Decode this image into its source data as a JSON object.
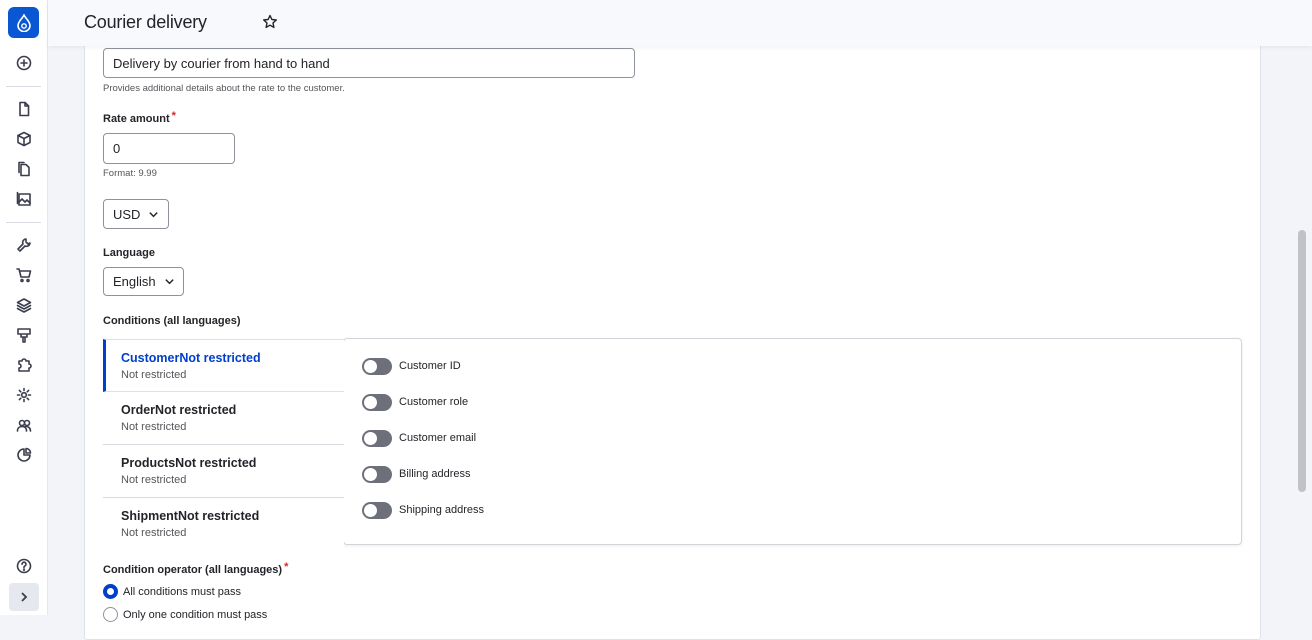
{
  "header": {
    "title": "Courier delivery"
  },
  "sidebar": {
    "icons": [
      "drupal-logo-icon",
      "add-circle-icon",
      "file-icon",
      "cube-icon",
      "files-icon",
      "image-icon",
      "wrench-icon",
      "cart-icon",
      "layers-icon",
      "paint-icon",
      "puzzle-icon",
      "gear-icon",
      "people-icon",
      "pie-chart-icon",
      "help-icon",
      "expand-chevron-icon"
    ]
  },
  "form": {
    "description_value": "Delivery by courier from hand to hand",
    "description_help": "Provides additional details about the rate to the customer.",
    "rate_label": "Rate amount",
    "rate_required": "*",
    "rate_value": "0",
    "rate_help": "Format: 9.99",
    "currency_value": "USD",
    "language_label": "Language",
    "language_value": "English",
    "conditions_label": "Conditions (all languages)",
    "tabs": [
      {
        "title": "CustomerNot restricted",
        "summary": "Not restricted"
      },
      {
        "title": "OrderNot restricted",
        "summary": "Not restricted"
      },
      {
        "title": "ProductsNot restricted",
        "summary": "Not restricted"
      },
      {
        "title": "ShipmentNot restricted",
        "summary": "Not restricted"
      }
    ],
    "toggles": [
      "Customer ID",
      "Customer role",
      "Customer email",
      "Billing address",
      "Shipping address"
    ],
    "operator_label": "Condition operator (all languages)",
    "operator_required": "*",
    "operator_options": [
      "All conditions must pass",
      "Only one condition must pass"
    ]
  },
  "colors": {
    "accent": "#003ecc",
    "logo": "#0a57d4",
    "toggle_off": "#6d6f7a",
    "required": "#dc2323"
  }
}
